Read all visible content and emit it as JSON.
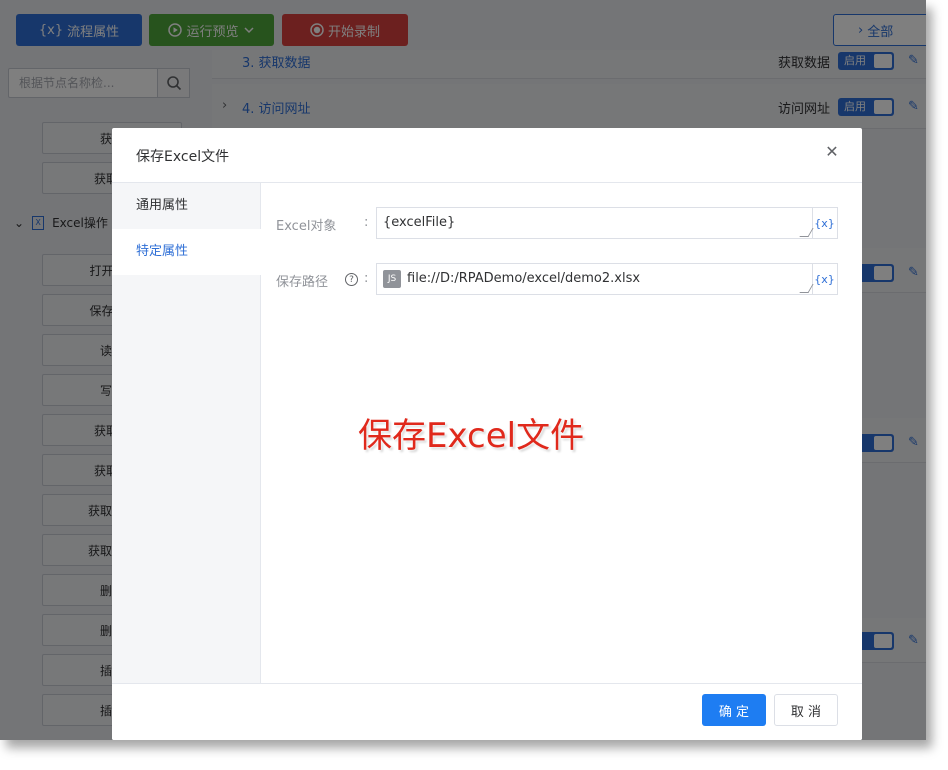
{
  "toolbar": {
    "flow_props": "流程属性",
    "flow_props_icon": "{x}",
    "run_preview": "运行预览",
    "start_recording": "开始录制",
    "expand_all": "全部"
  },
  "left_panel": {
    "search_placeholder": "根据节点名称检...",
    "nodes_top": [
      "获取",
      "获取附"
    ],
    "group_label": "Excel操作",
    "group_nodes": [
      "打开Exc",
      "保存Exc",
      "读取",
      "写入",
      "获取总",
      "获取总",
      "获取第一",
      "获取第一",
      "删除",
      "删除",
      "插入",
      "插入"
    ]
  },
  "flow_list": {
    "rows": [
      {
        "title": "3. 获取数据",
        "action": "获取数据",
        "toggle": "启用"
      },
      {
        "title": "4. 访问网址",
        "action": "访问网址",
        "toggle": "启用"
      }
    ],
    "extra_toggle": "启用"
  },
  "dialog": {
    "title": "保存Excel文件",
    "tabs": [
      "通用属性",
      "特定属性"
    ],
    "active_tab": 1,
    "fields": {
      "excel_object": {
        "label": "Excel对象",
        "value": "{excelFile}"
      },
      "save_path": {
        "label": "保存路径",
        "value": "file://D:/RPADemo/excel/demo2.xlsx",
        "badge": "JS"
      }
    },
    "colon": ":",
    "var_button": "{x}",
    "help_glyph": "?",
    "annotation": "保存Excel文件",
    "ok_label": "确 定",
    "cancel_label": "取 消"
  },
  "colors": {
    "primary": "#2f6fd6",
    "run_green": "#4fa63a",
    "record_red": "#d9413f",
    "annotation_red": "#e0291c"
  }
}
